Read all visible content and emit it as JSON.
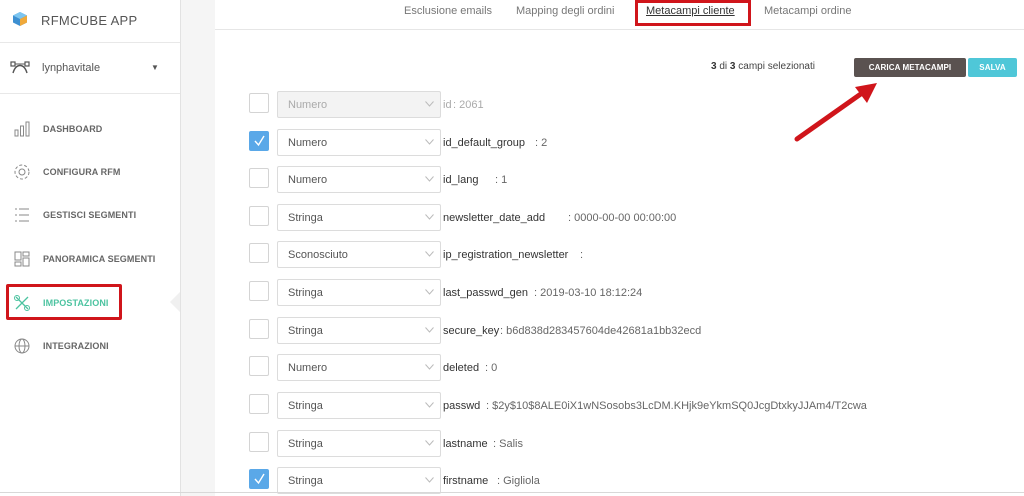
{
  "app": {
    "title": "RFMCUBE APP",
    "account": "lynphavitale"
  },
  "nav": {
    "items": [
      {
        "label": "DASHBOARD",
        "icon": "bar-chart-icon"
      },
      {
        "label": "CONFIGURA RFM",
        "icon": "gear-icon"
      },
      {
        "label": "GESTISCI SEGMENTI",
        "icon": "list-icon"
      },
      {
        "label": "PANORAMICA SEGMENTI",
        "icon": "grid-icon"
      },
      {
        "label": "IMPOSTAZIONI",
        "icon": "tools-icon",
        "active": true
      },
      {
        "label": "INTEGRAZIONI",
        "icon": "globe-icon"
      }
    ]
  },
  "tabs": [
    {
      "label": "Esclusione emails"
    },
    {
      "label": "Mapping degli ordini"
    },
    {
      "label": "Metacampi cliente",
      "active": true
    },
    {
      "label": "Metacampi ordine"
    }
  ],
  "selection": {
    "selected": "3",
    "of": "di",
    "total": "3",
    "suffix": "campi selezionati"
  },
  "buttons": {
    "carica": "CARICA METACAMPI",
    "salva": "SALVA"
  },
  "fields": [
    {
      "type": "Numero",
      "name": "id",
      "value": "2061",
      "checked": false,
      "disabled": true
    },
    {
      "type": "Numero",
      "name": "id_default_group",
      "value": "2",
      "checked": true,
      "disabled": false
    },
    {
      "type": "Numero",
      "name": "id_lang",
      "value": "1",
      "checked": false,
      "disabled": false
    },
    {
      "type": "Stringa",
      "name": "newsletter_date_add",
      "value": "0000-00-00 00:00:00",
      "checked": false,
      "disabled": false
    },
    {
      "type": "Sconosciuto",
      "name": "ip_registration_newsletter",
      "value": "",
      "checked": false,
      "disabled": false
    },
    {
      "type": "Stringa",
      "name": "last_passwd_gen",
      "value": "2019-03-10 18:12:24",
      "checked": false,
      "disabled": false
    },
    {
      "type": "Stringa",
      "name": "secure_key",
      "value": "b6d838d283457604de42681a1bb32ecd",
      "checked": false,
      "disabled": false
    },
    {
      "type": "Numero",
      "name": "deleted",
      "value": "0",
      "checked": false,
      "disabled": false
    },
    {
      "type": "Stringa",
      "name": "passwd",
      "value": "$2y$10$8ALE0iX1wNSosobs3LcDM.KHjk9eYkmSQ0JcgDtxkyJJAm4/T2cwa",
      "checked": false,
      "disabled": false
    },
    {
      "type": "Stringa",
      "name": "lastname",
      "value": "Salis",
      "checked": false,
      "disabled": false
    },
    {
      "type": "Stringa",
      "name": "firstname",
      "value": "Gigliola",
      "checked": true,
      "disabled": false
    }
  ],
  "colors": {
    "accent": "#4cc3a0",
    "highlight": "#d0151b",
    "checkbox": "#5aa8e8",
    "salva": "#4fc7d8",
    "carica": "#5a5250"
  }
}
